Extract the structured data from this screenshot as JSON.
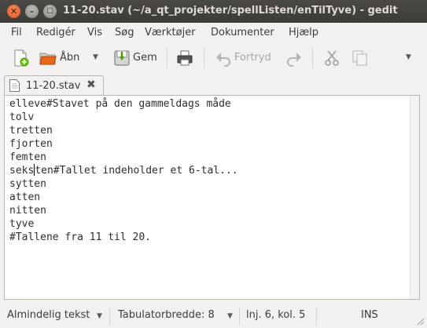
{
  "window": {
    "title": "11-20.stav (~/a_qt_projekter/spellListen/enTilTyve) - gedit",
    "controls": {
      "close": "✕",
      "minimize": "–",
      "maximize": "□"
    }
  },
  "menubar": {
    "items": [
      "Fil",
      "Redigér",
      "Vis",
      "Søg",
      "Værktøjer",
      "Dokumenter",
      "Hjælp"
    ]
  },
  "toolbar": {
    "new_icon": "new-document-icon",
    "open_label": "Åbn",
    "save_label": "Gem",
    "print_icon": "print-icon",
    "undo_label": "Fortryd",
    "redo_icon": "redo-icon",
    "cut_icon": "cut-icon",
    "copy_icon": "copy-icon",
    "overflow_icon": "chevron-down-icon"
  },
  "tab": {
    "label": "11-20.stav",
    "close": "✖"
  },
  "editor": {
    "lines": [
      "elleve#Stavet på den gammeldags måde",
      "tolv",
      "tretten",
      "fjorten",
      "femten",
      "seksten#Tallet indeholder et 6-tal...",
      "sytten",
      "atten",
      "nitten",
      "tyve",
      "#Tallene fra 11 til 20."
    ],
    "caret_line_before": "seks",
    "caret_line_after": "ten#Tallet indeholder et 6-tal..."
  },
  "statusbar": {
    "language": "Almindelig tekst",
    "tab_width": "Tabulatorbredde:  8",
    "position": "lnj. 6, kol. 5",
    "mode": "INS"
  }
}
